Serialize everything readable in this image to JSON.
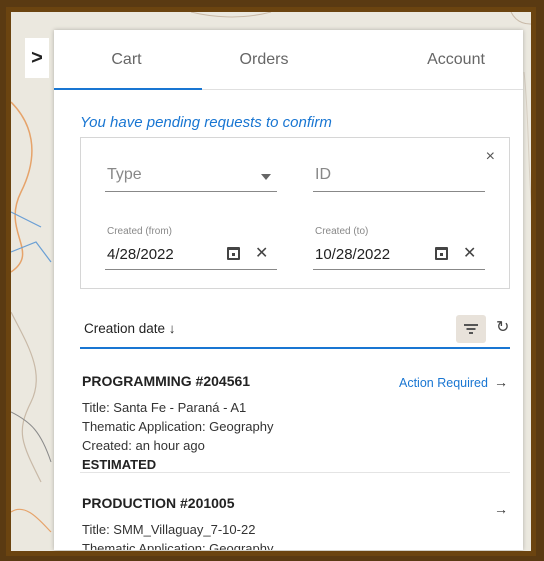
{
  "tabs": [
    {
      "label": "Cart"
    },
    {
      "label": "Orders"
    },
    {
      "label": "Account"
    }
  ],
  "toggle": {
    "glyph": ">"
  },
  "pending_notice": "You have pending requests to confirm",
  "filters": {
    "type_placeholder": "Type",
    "id_placeholder": "ID",
    "close_glyph": "×",
    "created_from_label": "Created (from)",
    "created_from_value": "4/28/2022",
    "created_to_label": "Created (to)",
    "created_to_value": "10/28/2022",
    "clear_glyph": "✕"
  },
  "sort": {
    "label": "Creation date ↓",
    "refresh_glyph": "↻"
  },
  "orders": [
    {
      "title": "PROGRAMMING #204561",
      "title_line": "Title: Santa Fe - Paraná - A1",
      "application_line": "Thematic Application: Geography",
      "created_line": "Created: an hour ago",
      "status": "ESTIMATED",
      "action": "Action Required",
      "arrow": "→"
    },
    {
      "title": "PRODUCTION #201005",
      "title_line": "Title: SMM_Villaguay_7-10-22",
      "application_line": "Thematic Application: Geography",
      "arrow": "→"
    }
  ],
  "colors": {
    "accent": "#1976d2",
    "frame": "#6b4410"
  }
}
